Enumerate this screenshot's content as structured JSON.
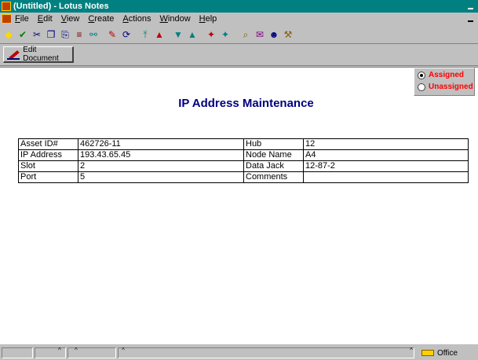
{
  "window": {
    "title": "(Untitled) - Lotus Notes"
  },
  "menu": {
    "items": [
      "File",
      "Edit",
      "View",
      "Create",
      "Actions",
      "Window",
      "Help"
    ]
  },
  "toolbar": {
    "buttons": [
      {
        "name": "smarticon-cycle",
        "color": "#ffd800",
        "glyph": "◆"
      },
      {
        "name": "smarticon-check",
        "color": "#008000",
        "glyph": "✔"
      },
      {
        "name": "smarticon-cut",
        "color": "#000080",
        "glyph": "✂"
      },
      {
        "name": "smarticon-copy",
        "color": "#000080",
        "glyph": "❐"
      },
      {
        "name": "smarticon-paste",
        "color": "#000080",
        "glyph": "⎘"
      },
      {
        "name": "smarticon-ruler",
        "color": "#800000",
        "glyph": "≡"
      },
      {
        "name": "smarticon-link",
        "color": "#008080",
        "glyph": "⚯"
      },
      {
        "name": "smarticon-edit",
        "color": "#c00000",
        "glyph": "✎"
      },
      {
        "name": "smarticon-refresh",
        "color": "#000080",
        "glyph": "⟳"
      },
      {
        "name": "smarticon-first",
        "color": "#008080",
        "glyph": "⤒"
      },
      {
        "name": "smarticon-previous",
        "color": "#c00000",
        "glyph": "▲"
      },
      {
        "name": "smarticon-down",
        "color": "#008080",
        "glyph": "▼"
      },
      {
        "name": "smarticon-up",
        "color": "#008080",
        "glyph": "▲"
      },
      {
        "name": "smarticon-next-unread",
        "color": "#c00000",
        "glyph": "✦"
      },
      {
        "name": "smarticon-prev-unread",
        "color": "#008080",
        "glyph": "✦"
      },
      {
        "name": "smarticon-search",
        "color": "#806000",
        "glyph": "⌕"
      },
      {
        "name": "smarticon-properties",
        "color": "#800080",
        "glyph": "✉"
      },
      {
        "name": "smarticon-people",
        "color": "#000080",
        "glyph": "☻"
      },
      {
        "name": "smarticon-tools",
        "color": "#806000",
        "glyph": "⚒"
      }
    ]
  },
  "actionbar": {
    "edit_document_label": "Edit Document"
  },
  "radio": {
    "options": [
      "Assigned",
      "Unassigned"
    ],
    "selected": "Assigned",
    "label_color": "#ff0000"
  },
  "form": {
    "title": "IP Address Maintenance",
    "title_color": "#000080",
    "rows": [
      {
        "label1": "Asset ID#",
        "value1": "462726-11",
        "label2": "Hub",
        "value2": "12"
      },
      {
        "label1": "IP Address",
        "value1": "193.43.65.45",
        "label2": "Node Name",
        "value2": "A4"
      },
      {
        "label1": "Slot",
        "value1": "2",
        "label2": "Data Jack",
        "value2": "12-87-2"
      },
      {
        "label1": "Port",
        "value1": "5",
        "label2": "Comments",
        "value2": ""
      }
    ]
  },
  "statusbar": {
    "office_label": "Office"
  }
}
